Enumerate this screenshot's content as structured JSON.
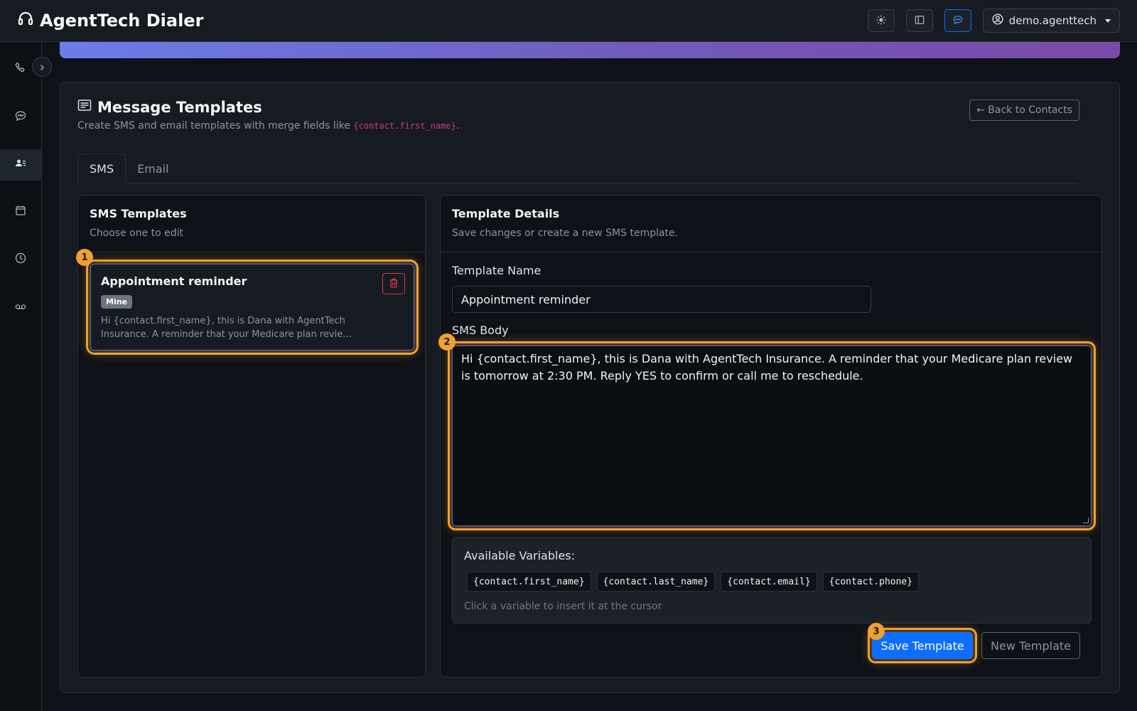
{
  "app": {
    "title": "AgentTech Dialer",
    "user": "demo.agenttech"
  },
  "colors": {
    "accent": "#0d6efd",
    "highlight": "#f0a030",
    "danger": "#dc3545",
    "code": "#d63384"
  },
  "navbar": {
    "icons": [
      "sun-icon",
      "sidebar-icon",
      "chat-icon",
      "user-circle-icon"
    ]
  },
  "sidebar": {
    "items": [
      {
        "icon": "phone-icon"
      },
      {
        "icon": "chat-bubble-icon"
      },
      {
        "icon": "contacts-icon",
        "active": true
      },
      {
        "icon": "calendar-icon"
      },
      {
        "icon": "clock-icon"
      },
      {
        "icon": "voicemail-icon"
      }
    ]
  },
  "page": {
    "title": "Message Templates",
    "subtitle_prefix": "Create SMS and email templates with merge fields like ",
    "subtitle_code": "{contact.first_name}",
    "subtitle_suffix": ".",
    "back_button": "← Back to Contacts",
    "tabs": [
      {
        "label": "SMS",
        "active": true
      },
      {
        "label": "Email",
        "active": false
      }
    ]
  },
  "left_panel": {
    "title": "SMS Templates",
    "subtitle": "Choose one to edit",
    "templates": [
      {
        "name": "Appointment reminder",
        "badge": "Mine",
        "preview": "Hi {contact.first_name}, this is Dana with AgentTech Insurance. A reminder that your Medicare plan revie..."
      }
    ]
  },
  "right_panel": {
    "title": "Template Details",
    "subtitle": "Save changes or create a new SMS template.",
    "name_label": "Template Name",
    "name_value": "Appointment reminder",
    "body_label": "SMS Body",
    "body_value": "Hi {contact.first_name}, this is Dana with AgentTech Insurance. A reminder that your Medicare plan review is tomorrow at 2:30 PM. Reply YES to confirm or call me to reschedule.",
    "vars_title": "Available Variables:",
    "variables": [
      "{contact.first_name}",
      "{contact.last_name}",
      "{contact.email}",
      "{contact.phone}"
    ],
    "vars_hint": "Click a variable to insert it at the cursor",
    "save_button": "Save Template",
    "new_button": "New Template"
  },
  "markers": [
    "1",
    "2",
    "3"
  ]
}
